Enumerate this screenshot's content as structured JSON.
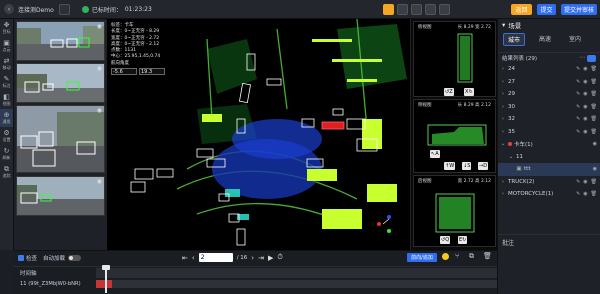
{
  "topbar": {
    "project_name": "连接测Demo",
    "timer_label": "已标时间：",
    "timer_value": "01:23:23",
    "btn_prev": "返回",
    "btn_submit": "提交",
    "btn_submit_review": "提交并审核"
  },
  "leftbar": {
    "items": [
      {
        "glyph": "✥",
        "label": "目标"
      },
      {
        "glyph": "▣",
        "label": "点云"
      },
      {
        "glyph": "⇄",
        "label": "移动"
      },
      {
        "glyph": "✎",
        "label": "标注"
      },
      {
        "glyph": "◧",
        "label": "视图"
      },
      {
        "glyph": "⊕",
        "label": "通用"
      },
      {
        "glyph": "⚙",
        "label": "设置"
      },
      {
        "glyph": "↻",
        "label": "刷新"
      },
      {
        "glyph": "⧉",
        "label": "追踪"
      }
    ]
  },
  "main": {
    "info": {
      "label_line": "标签：卡车",
      "length_line": "长度：0~正无穷 - 8.29",
      "width_line": "宽度：0~正无穷 - 2.72",
      "height_line": "高度：0~正无穷 - 2.12",
      "points_line": "点数：1131",
      "center_line": "中心：25.95,1.45,0.74",
      "rotation_line": "航向角度",
      "input_a": "-5.6",
      "input_b": "19.3"
    }
  },
  "views": {
    "top": {
      "title": "俯视图",
      "dims": "长 8.29 宽 2.72",
      "btn_z_left": "Z",
      "btn_x": "X"
    },
    "side": {
      "title": "侧视图",
      "dims": "长 8.29 高 2.12",
      "btn_a": "A",
      "btn_w": "W",
      "btn_s": "S",
      "btn_d": "D"
    },
    "back": {
      "title": "后视图",
      "dims": "宽 2.72 高 2.12",
      "btn_q": "Q",
      "btn_e": "E"
    }
  },
  "right": {
    "scene_title": "场景",
    "tabs": [
      "城市",
      "高速",
      "室内"
    ],
    "result_header": "结果列表 (29)",
    "rows": [
      {
        "caret": "›",
        "label": "24"
      },
      {
        "caret": "›",
        "label": "27"
      },
      {
        "caret": "›",
        "label": "29"
      },
      {
        "caret": "›",
        "label": "30"
      },
      {
        "caret": "›",
        "label": "32"
      },
      {
        "caret": "›",
        "label": "35"
      },
      {
        "caret": "⌄",
        "label": "卡车(1)"
      },
      {
        "caret": "⌄",
        "label": "11"
      },
      {
        "caret": "",
        "label": "ttt"
      },
      {
        "caret": "›",
        "label": "TRUCK(2)"
      },
      {
        "caret": "›",
        "label": "MOTORCYCLE(1)"
      }
    ],
    "note_title": "批注"
  },
  "bottom": {
    "check_label": "检查",
    "autoload_label": "自动加载",
    "page_current": "2",
    "page_total": "/ 16",
    "pre_label": "前向/追加",
    "timeline_label": "时间轴",
    "track_label": "11 (99t_Z3MbjW0-bNR)"
  },
  "colors": {
    "accent": "#2f6df0",
    "warn": "#f5a623",
    "danger": "#e04848",
    "ok": "#2fb35c"
  }
}
